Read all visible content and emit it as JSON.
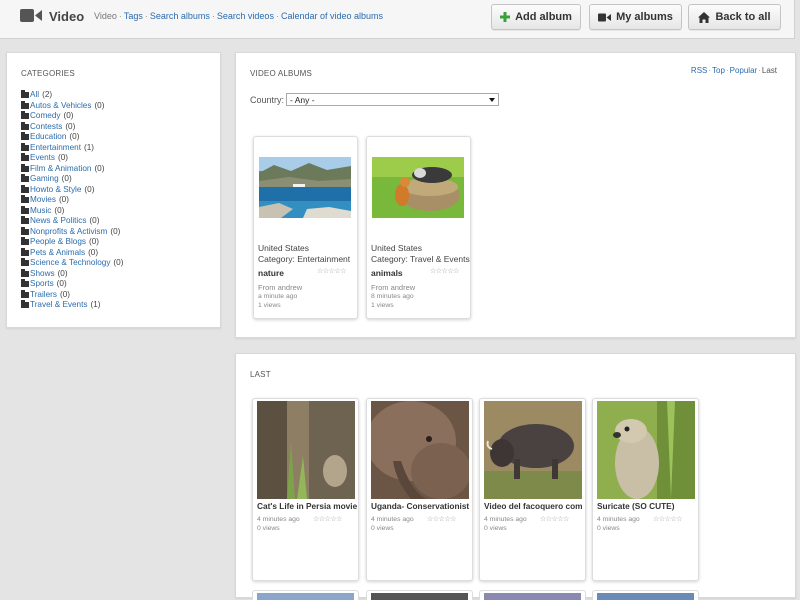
{
  "header": {
    "title": "Video",
    "nav": {
      "current": "Video",
      "links": [
        "Tags",
        "Search albums",
        "Search videos",
        "Calendar of video albums"
      ]
    },
    "buttons": {
      "add_album": "Add album",
      "my_albums": "My albums",
      "back_to_all": "Back to all"
    }
  },
  "categories": {
    "title": "CATEGORIES",
    "items": [
      {
        "label": "All",
        "count": "(2)"
      },
      {
        "label": "Autos & Vehicles",
        "count": "(0)"
      },
      {
        "label": "Comedy",
        "count": "(0)"
      },
      {
        "label": "Contests",
        "count": "(0)"
      },
      {
        "label": "Education",
        "count": "(0)"
      },
      {
        "label": "Entertainment",
        "count": "(1)"
      },
      {
        "label": "Events",
        "count": "(0)"
      },
      {
        "label": "Film & Animation",
        "count": "(0)"
      },
      {
        "label": "Gaming",
        "count": "(0)"
      },
      {
        "label": "Howto & Style",
        "count": "(0)"
      },
      {
        "label": "Movies",
        "count": "(0)"
      },
      {
        "label": "Music",
        "count": "(0)"
      },
      {
        "label": "News & Politics",
        "count": "(0)"
      },
      {
        "label": "Nonprofits & Activism",
        "count": "(0)"
      },
      {
        "label": "People & Blogs",
        "count": "(0)"
      },
      {
        "label": "Pets & Animals",
        "count": "(0)"
      },
      {
        "label": "Science & Technology",
        "count": "(0)"
      },
      {
        "label": "Shows",
        "count": "(0)"
      },
      {
        "label": "Sports",
        "count": "(0)"
      },
      {
        "label": "Trailers",
        "count": "(0)"
      },
      {
        "label": "Travel & Events",
        "count": "(1)"
      }
    ]
  },
  "albums_panel": {
    "title": "VIDEO ALBUMS",
    "sort": {
      "rss": "RSS",
      "top": "Top",
      "popular": "Popular",
      "last": "Last"
    },
    "country_label": "Country:",
    "country_value": "- Any -",
    "albums": [
      {
        "country": "United States",
        "category": "Category: Entertainment",
        "name": "nature",
        "from": "From andrew",
        "time": "a minute ago",
        "views": "1 views",
        "rating": "☆☆☆☆☆"
      },
      {
        "country": "United States",
        "category": "Category: Travel & Events",
        "name": "animals",
        "from": "From andrew",
        "time": "8 minutes ago",
        "views": "1 views",
        "rating": "☆☆☆☆☆"
      }
    ]
  },
  "last_panel": {
    "title": "LAST",
    "videos": [
      {
        "title": "Cat's Life in Persia movie",
        "time": "4 minutes ago",
        "views": "0 views",
        "rating": "☆☆☆☆☆"
      },
      {
        "title": "Uganda- Conservationist",
        "time": "4 minutes ago",
        "views": "0 views",
        "rating": "☆☆☆☆☆"
      },
      {
        "title": "Video del facoquero com",
        "time": "4 minutes ago",
        "views": "0 views",
        "rating": "☆☆☆☆☆"
      },
      {
        "title": "Suricate (SO CUTE)",
        "time": "4 minutes ago",
        "views": "0 views",
        "rating": "☆☆☆☆☆"
      }
    ]
  },
  "colors": {
    "link": "#2a6cae",
    "add_icon": "#3aa13a",
    "background": "#e4e4e4"
  }
}
